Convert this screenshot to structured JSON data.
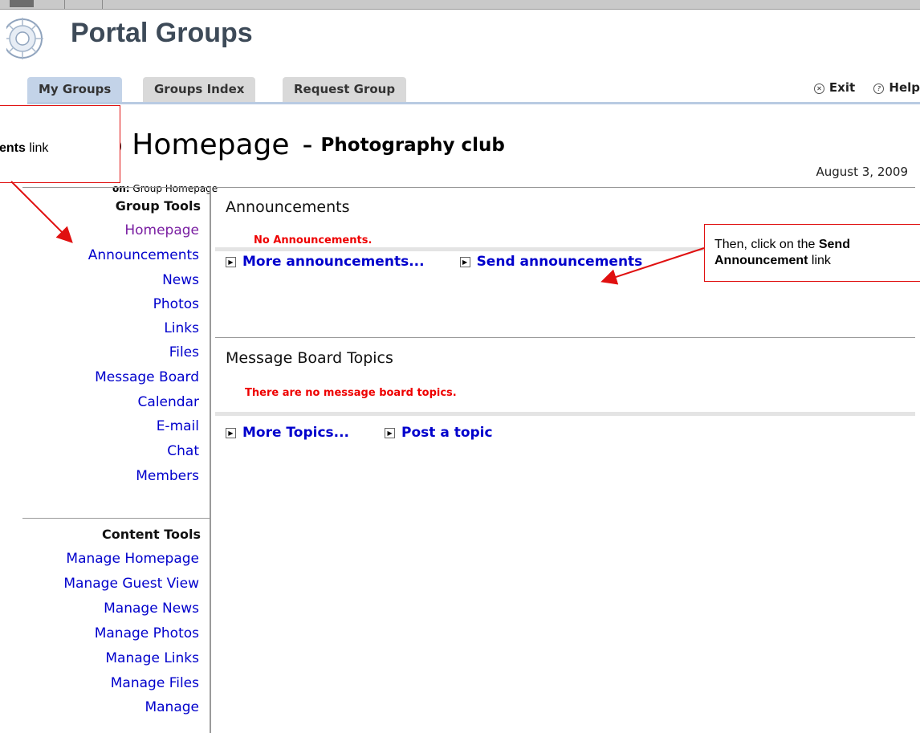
{
  "app": {
    "title": "Portal Groups"
  },
  "tabs": [
    {
      "label": "My Groups",
      "active": true
    },
    {
      "label": "Groups Index",
      "active": false
    },
    {
      "label": "Request Group",
      "active": false
    }
  ],
  "top_links": {
    "exit": "Exit",
    "help": "Help"
  },
  "page": {
    "heading_prefix": "p Homepage",
    "heading_dash": "-",
    "group_name": "Photography club",
    "location_label": "on:",
    "location_value": "Group Homepage",
    "date": "August 3, 2009"
  },
  "sidebar": {
    "group_tools": {
      "heading": "Group Tools",
      "items": [
        "Homepage",
        "Announcements",
        "News",
        "Photos",
        "Links",
        "Files",
        "Message Board",
        "Calendar",
        "E-mail",
        "Chat",
        "Members"
      ]
    },
    "content_tools": {
      "heading": "Content Tools",
      "items": [
        "Manage Homepage",
        "Manage Guest View",
        "Manage News",
        "Manage Photos",
        "Manage Links",
        "Manage Files",
        "Manage"
      ]
    }
  },
  "announcements": {
    "title": "Announcements",
    "empty": "No Announcements.",
    "more": "More announcements...",
    "send": "Send announcements"
  },
  "message_board": {
    "title": "Message Board Topics",
    "empty": "There are no message board topics.",
    "more": "More Topics...",
    "post": "Post a topic"
  },
  "callouts": {
    "left": {
      "bold": "ents",
      "text": " link"
    },
    "right": {
      "line1": "Then, click on the ",
      "line1_bold": "Send",
      "line2_bold": "Announcement",
      "line2": " link"
    }
  },
  "colors": {
    "link": "#0000cc",
    "visited": "#7a1fa2",
    "error": "#ee0000",
    "callout_border": "#e01010",
    "tab_active": "#c3d3e8"
  }
}
